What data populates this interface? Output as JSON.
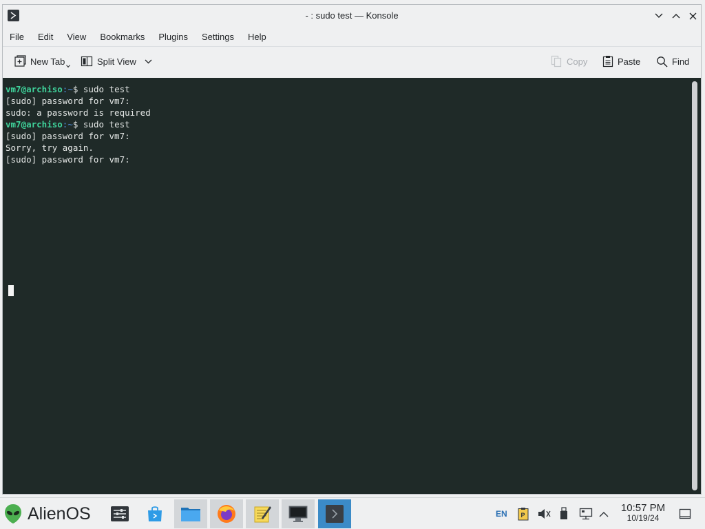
{
  "window": {
    "title": "- : sudo test — Konsole"
  },
  "menu": [
    "File",
    "Edit",
    "View",
    "Bookmarks",
    "Plugins",
    "Settings",
    "Help"
  ],
  "toolbar": {
    "new_tab": "New Tab",
    "split_view": "Split View",
    "copy": "Copy",
    "paste": "Paste",
    "find": "Find"
  },
  "terminal": {
    "lines": [
      {
        "user": "vm7@archiso",
        "path": ":~",
        "cmd": "$ sudo test"
      },
      {
        "text": "[sudo] password for vm7:"
      },
      {
        "text": "sudo: a password is required"
      },
      {
        "user": "vm7@archiso",
        "path": ":~",
        "cmd": "$ sudo test"
      },
      {
        "text": "[sudo] password for vm7:"
      },
      {
        "text": "Sorry, try again."
      },
      {
        "text": "[sudo] password for vm7:"
      }
    ]
  },
  "taskbar": {
    "start_label": "AlienOS",
    "apps": [
      "settings-icon",
      "store-icon",
      "files-icon",
      "firefox-icon",
      "notes-icon",
      "monitor-icon",
      "konsole-icon"
    ],
    "active_app": "konsole-icon",
    "keyboard_layout": "EN",
    "clock_time": "10:57 PM",
    "clock_date": "10/19/24"
  },
  "colors": {
    "terminal_bg": "#1f2a28",
    "prompt_user": "#3fd19a",
    "prompt_path": "#4f8fe0",
    "active_task": "#3b8bc7"
  }
}
